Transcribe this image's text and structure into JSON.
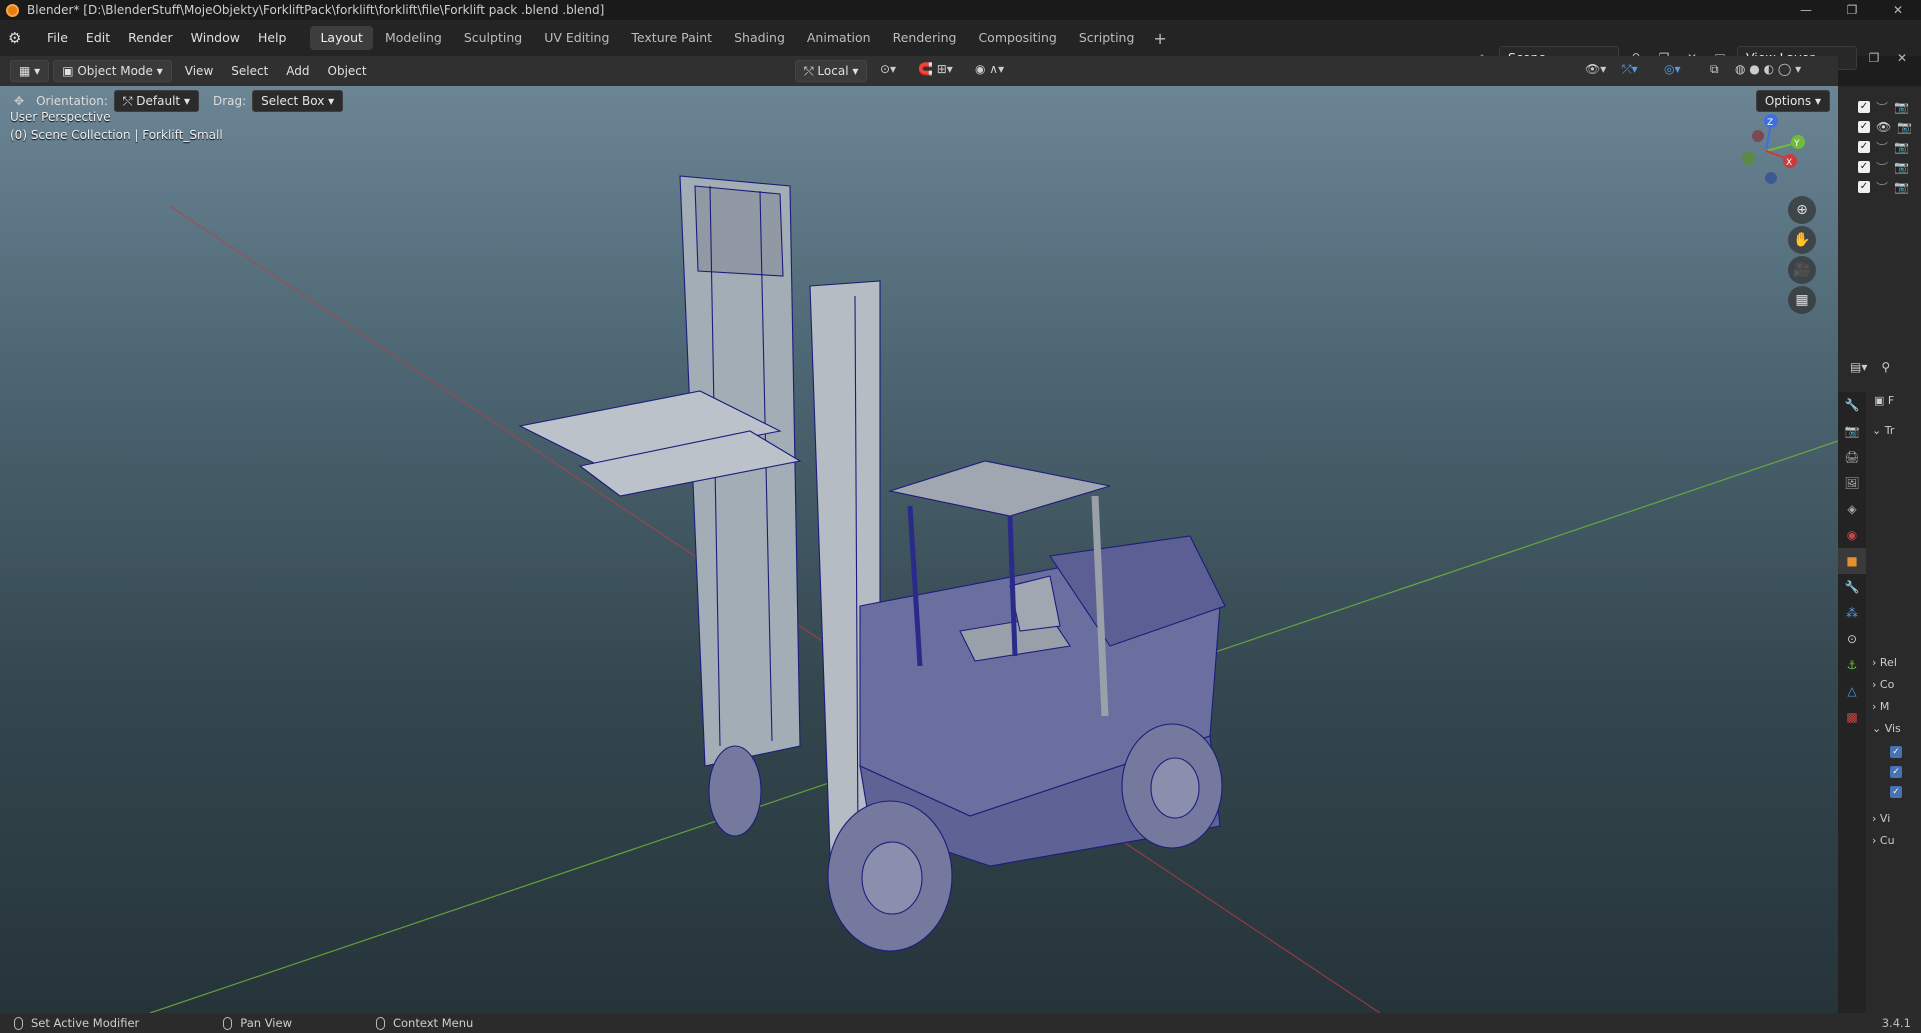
{
  "window": {
    "title": "Blender* [D:\\BlenderStuff\\MojeObjekty\\ForkliftPack\\forklift\\forklift\\file\\Forklift pack .blend .blend]",
    "controls": [
      "—",
      "❐",
      "✕"
    ]
  },
  "menubar": {
    "menus": [
      "File",
      "Edit",
      "Render",
      "Window",
      "Help"
    ],
    "workspaces": [
      "Layout",
      "Modeling",
      "Sculpting",
      "UV Editing",
      "Texture Paint",
      "Shading",
      "Animation",
      "Rendering",
      "Compositing",
      "Scripting"
    ],
    "active_workspace": "Layout",
    "add_tab": "+",
    "scene": "Scene",
    "view_layer": "View Layer"
  },
  "header": {
    "mode": "Object Mode",
    "menus": [
      "View",
      "Select",
      "Add",
      "Object"
    ],
    "transform_orientation": "Local"
  },
  "toolbar": {
    "orientation_label": "Orientation:",
    "orientation_value": "Default",
    "drag_label": "Drag:",
    "drag_value": "Select Box",
    "options_label": "Options"
  },
  "viewport": {
    "view_name": "User Perspective",
    "collection_info": "(0) Scene Collection | Forklift_Small",
    "gizmo_axes": [
      "Z",
      "Y",
      "X"
    ],
    "nav_icons": [
      "zoom-icon",
      "hand-pan-icon",
      "camera-icon",
      "grid-icon"
    ]
  },
  "outliner": {
    "row_count": 5
  },
  "properties": {
    "rows": [
      "Tr",
      "Rel",
      "Co",
      "M",
      "Vis",
      "Vi",
      "Cu"
    ],
    "header_field": "F"
  },
  "statusbar": {
    "items": [
      "Set Active Modifier",
      "Pan View",
      "Context Menu"
    ],
    "version": "3.4.1"
  },
  "colors": {
    "accent": "#4772b3",
    "axis_x": "#c83c3c",
    "axis_y": "#6fbb3a",
    "axis_z": "#3c6fe0",
    "wire": "#1c1c8c"
  }
}
